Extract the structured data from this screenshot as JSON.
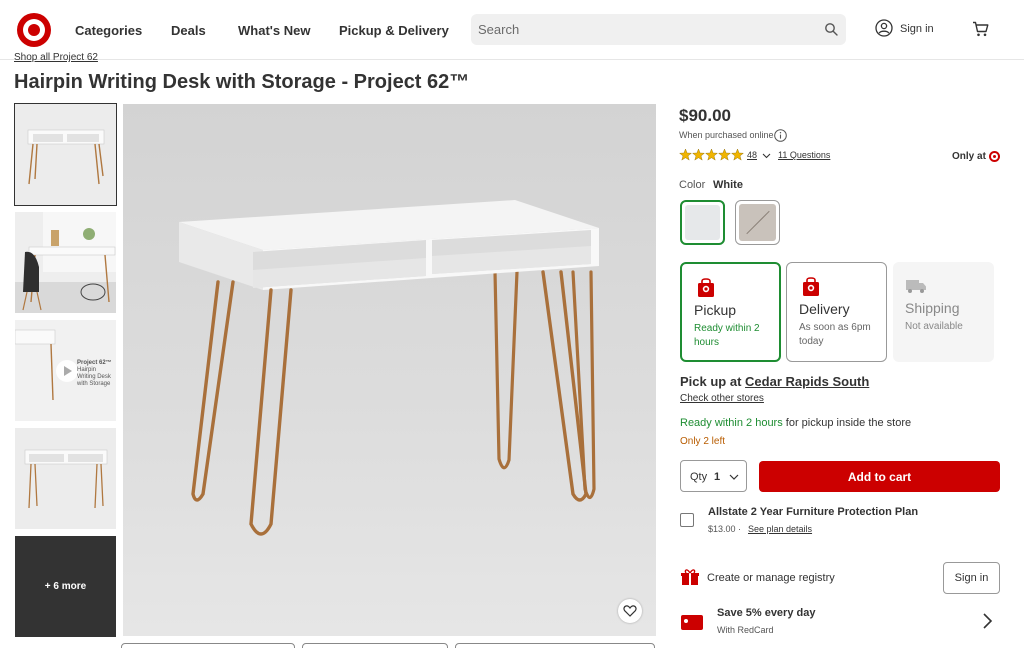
{
  "header": {
    "nav": [
      "Categories",
      "Deals",
      "What's New",
      "Pickup & Delivery"
    ],
    "search_placeholder": "Search",
    "signin_label": "Sign in"
  },
  "breadcrumb": "Shop all Project 62",
  "product": {
    "title": "Hairpin Writing Desk with Storage - Project 62™",
    "price": "$90.00",
    "price_note": "When purchased online",
    "rating": 5,
    "rating_count": "48",
    "questions": "11 Questions",
    "only_at": "Only at",
    "color_label": "Color",
    "color_value": "White"
  },
  "gallery": {
    "video_title": "Project 62™",
    "video_subtitle": "Hairpin Writing Desk with Storage",
    "more_label": "+ 6 more"
  },
  "fulfillment": [
    {
      "title": "Pickup",
      "subtitle": "Ready within 2 hours"
    },
    {
      "title": "Delivery",
      "subtitle": "As soon as 6pm today"
    },
    {
      "title": "Shipping",
      "subtitle": "Not available"
    }
  ],
  "pickup": {
    "prefix": "Pick up at",
    "store": "Cedar Rapids South",
    "check_stores": "Check other stores",
    "ready_highlight": "Ready within 2 hours",
    "ready_rest": " for pickup inside the store",
    "stock_note": "Only 2 left"
  },
  "cart": {
    "qty_label": "Qty",
    "qty_value": "1",
    "add_label": "Add to cart"
  },
  "protection_plan": {
    "title": "Allstate 2 Year Furniture Protection Plan",
    "price": "$13.00 ·",
    "link": "See plan details"
  },
  "registry": {
    "text": "Create or manage registry",
    "button": "Sign in"
  },
  "redcard": {
    "title": "Save 5% every day",
    "subtitle": "With RedCard"
  },
  "colors": {
    "brand": "#cc0000",
    "success": "#1e8d32",
    "warning": "#b85c00",
    "text": "#333333"
  },
  "icons": [
    "target-logo",
    "search-icon",
    "account-icon",
    "cart-icon",
    "info-icon",
    "star-icon",
    "chevron-down-icon",
    "heart-icon",
    "store-icon",
    "truck-icon",
    "gift-icon",
    "chevron-right-icon"
  ]
}
